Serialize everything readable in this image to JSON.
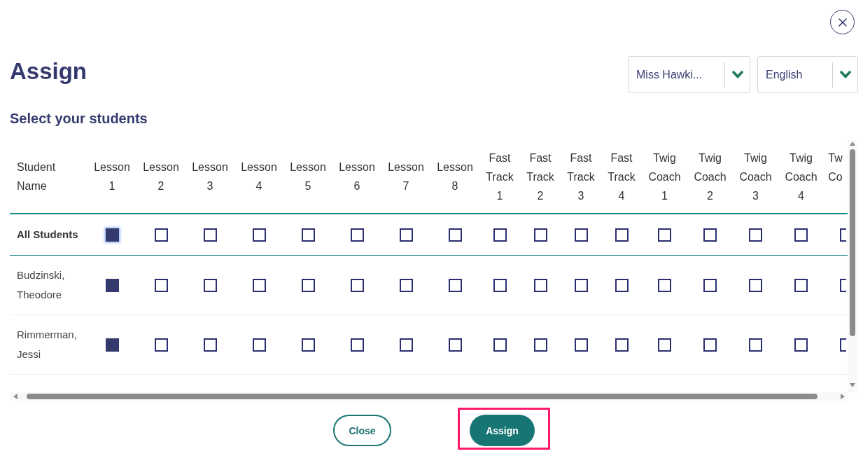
{
  "title": "Assign",
  "dropdowns": [
    {
      "value": "Miss Hawki..."
    },
    {
      "value": "English"
    }
  ],
  "subtitle": "Select your students",
  "table": {
    "columns": [
      {
        "label": "Student Name",
        "kind": "name"
      },
      {
        "label": "Lesson 1",
        "kind": "lesson"
      },
      {
        "label": "Lesson 2",
        "kind": "lesson"
      },
      {
        "label": "Lesson 3",
        "kind": "lesson"
      },
      {
        "label": "Lesson 4",
        "kind": "lesson"
      },
      {
        "label": "Lesson 5",
        "kind": "lesson"
      },
      {
        "label": "Lesson 6",
        "kind": "lesson"
      },
      {
        "label": "Lesson 7",
        "kind": "lesson"
      },
      {
        "label": "Lesson 8",
        "kind": "lesson"
      },
      {
        "label": "Fast Track 1",
        "kind": "fast_track"
      },
      {
        "label": "Fast Track 2",
        "kind": "fast_track"
      },
      {
        "label": "Fast Track 3",
        "kind": "fast_track"
      },
      {
        "label": "Fast Track 4",
        "kind": "fast_track"
      },
      {
        "label": "Twig Coach 1",
        "kind": "twig_coach"
      },
      {
        "label": "Twig Coach 2",
        "kind": "twig_coach"
      },
      {
        "label": "Twig Coach 3",
        "kind": "twig_coach"
      },
      {
        "label": "Twig Coach 4",
        "kind": "twig_coach"
      },
      {
        "label": "Tw Co",
        "kind": "partial"
      }
    ],
    "rows": [
      {
        "name": "All Students",
        "kind": "all",
        "cells": [
          {
            "checked": true,
            "focused": true
          },
          {
            "checked": false,
            "focused": false
          },
          {
            "checked": false,
            "focused": false
          },
          {
            "checked": false,
            "focused": false
          },
          {
            "checked": false,
            "focused": false
          },
          {
            "checked": false,
            "focused": false
          },
          {
            "checked": false,
            "focused": false
          },
          {
            "checked": false,
            "focused": false
          },
          {
            "checked": false,
            "focused": false
          },
          {
            "checked": false,
            "focused": false
          },
          {
            "checked": false,
            "focused": false
          },
          {
            "checked": false,
            "focused": false
          },
          {
            "checked": false,
            "focused": false
          },
          {
            "checked": false,
            "focused": false
          },
          {
            "checked": false,
            "focused": false
          },
          {
            "checked": false,
            "focused": false
          },
          {
            "checked": false,
            "focused": false
          }
        ]
      },
      {
        "name": "Budzinski, Theodore",
        "kind": "student",
        "cells": [
          {
            "checked": true,
            "focused": false
          },
          {
            "checked": false,
            "focused": false
          },
          {
            "checked": false,
            "focused": false
          },
          {
            "checked": false,
            "focused": false
          },
          {
            "checked": false,
            "focused": false
          },
          {
            "checked": false,
            "focused": false
          },
          {
            "checked": false,
            "focused": false
          },
          {
            "checked": false,
            "focused": false
          },
          {
            "checked": false,
            "focused": false
          },
          {
            "checked": false,
            "focused": false
          },
          {
            "checked": false,
            "focused": false
          },
          {
            "checked": false,
            "focused": false
          },
          {
            "checked": false,
            "focused": false
          },
          {
            "checked": false,
            "focused": false
          },
          {
            "checked": false,
            "focused": false
          },
          {
            "checked": false,
            "focused": false
          },
          {
            "checked": false,
            "focused": false
          }
        ]
      },
      {
        "name": "Rimmerman, Jessi",
        "kind": "student",
        "cells": [
          {
            "checked": true,
            "focused": false
          },
          {
            "checked": false,
            "focused": false
          },
          {
            "checked": false,
            "focused": false
          },
          {
            "checked": false,
            "focused": false
          },
          {
            "checked": false,
            "focused": false
          },
          {
            "checked": false,
            "focused": false
          },
          {
            "checked": false,
            "focused": false
          },
          {
            "checked": false,
            "focused": false
          },
          {
            "checked": false,
            "focused": false
          },
          {
            "checked": false,
            "focused": false
          },
          {
            "checked": false,
            "focused": false
          },
          {
            "checked": false,
            "focused": false
          },
          {
            "checked": false,
            "focused": false
          },
          {
            "checked": false,
            "focused": false
          },
          {
            "checked": false,
            "focused": false
          },
          {
            "checked": false,
            "focused": false
          },
          {
            "checked": false,
            "focused": false
          }
        ]
      }
    ]
  },
  "buttons": [
    {
      "label": "Close",
      "kind": "secondary",
      "highlighted": false
    },
    {
      "label": "Assign",
      "kind": "primary",
      "highlighted": true
    }
  ]
}
